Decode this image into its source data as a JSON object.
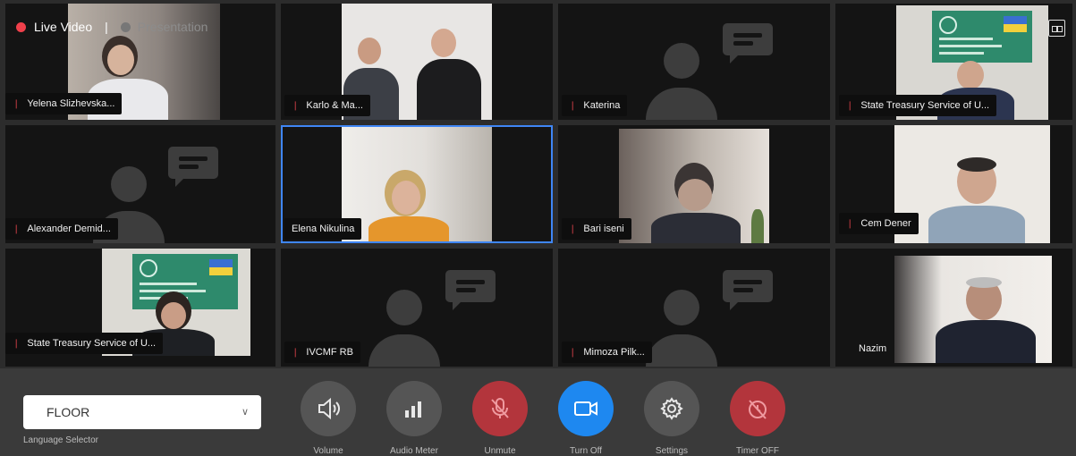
{
  "top_bar": {
    "live_label": "Live Video",
    "separator": "|",
    "presentation_label": "Presentation"
  },
  "participants": [
    {
      "name": "Yelena Slizhevska...",
      "muted": true,
      "video": true
    },
    {
      "name": "Karlo & Ma...",
      "muted": true,
      "video": true
    },
    {
      "name": "Katerina",
      "muted": true,
      "video": false
    },
    {
      "name": "State Treasury Service of U...",
      "muted": true,
      "video": true
    },
    {
      "name": "Alexander Demid...",
      "muted": true,
      "video": false
    },
    {
      "name": "Elena Nikulina",
      "muted": false,
      "video": true,
      "active_speaker": true
    },
    {
      "name": "Bari iseni",
      "muted": true,
      "video": true
    },
    {
      "name": "Cem Dener",
      "muted": true,
      "video": true
    },
    {
      "name": "State Treasury Service of U...",
      "muted": true,
      "video": true
    },
    {
      "name": "IVCMF RB",
      "muted": true,
      "video": false
    },
    {
      "name": "Mimoza Pilk...",
      "muted": true,
      "video": false
    },
    {
      "name": "Nazim",
      "muted": false,
      "video": true
    }
  ],
  "language": {
    "selected": "FLOOR",
    "label": "Language Selector"
  },
  "controls": {
    "volume": "Volume",
    "audio_meter": "Audio Meter",
    "unmute": "Unmute",
    "turn_off": "Turn Off",
    "settings": "Settings",
    "timer_off": "Timer OFF"
  },
  "colors": {
    "live": "#f0404b",
    "active_outline": "#3f86f5",
    "mute_red": "#b3353c",
    "camera_blue": "#1e88f0",
    "control_gray": "#555555"
  }
}
